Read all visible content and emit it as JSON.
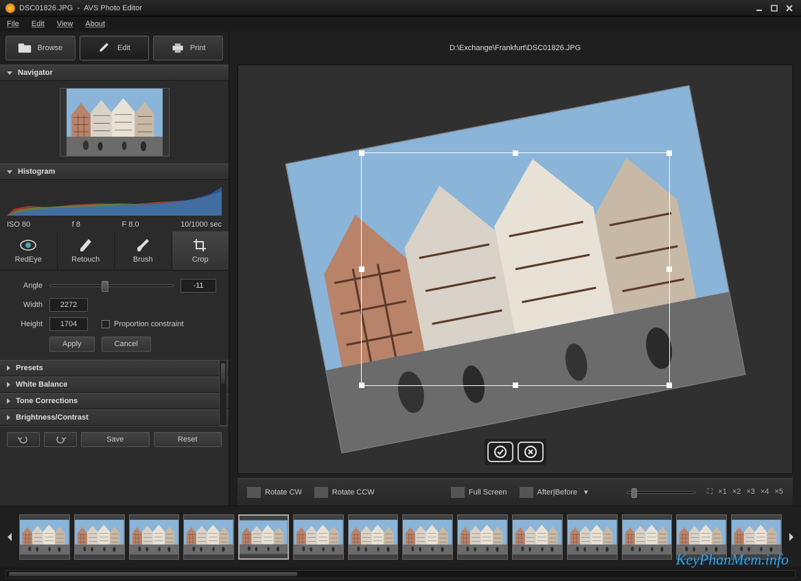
{
  "titlebar": {
    "filename": "DSC01826.JPG",
    "app": "AVS Photo Editor"
  },
  "menu": {
    "file": "File",
    "edit": "Edit",
    "view": "View",
    "about": "About"
  },
  "modes": {
    "browse": "Browse",
    "edit": "Edit",
    "print": "Print"
  },
  "sidebar": {
    "navigator": "Navigator",
    "histogram": "Histogram",
    "histo_info": {
      "iso": "ISO 80",
      "f1": "f 8",
      "f2": "F 8.0",
      "shutter": "10/1000 sec"
    },
    "tools": {
      "redeye": "RedEye",
      "retouch": "Retouch",
      "brush": "Brush",
      "crop": "Crop"
    },
    "crop": {
      "angle_label": "Angle",
      "angle_value": "-11",
      "width_label": "Width",
      "width_value": "2272",
      "height_label": "Height",
      "height_value": "1704",
      "proportion": "Proportion constraint",
      "apply": "Apply",
      "cancel": "Cancel"
    },
    "panels": {
      "presets": "Presets",
      "white_balance": "White Balance",
      "tone": "Tone Corrections",
      "brightness": "Brightness/Contrast"
    },
    "actions": {
      "save": "Save",
      "reset": "Reset"
    }
  },
  "canvas": {
    "filepath": "D:\\Exchange\\Frankfurt\\DSC01826.JPG"
  },
  "toolbar": {
    "rotate_cw": "Rotate CW",
    "rotate_ccw": "Rotate CCW",
    "fullscreen": "Full Screen",
    "after_before": "After|Before",
    "zoom": {
      "fit": "⛶",
      "x1": "×1",
      "x2": "×2",
      "x3": "×3",
      "x4": "×4",
      "x5": "×5"
    }
  },
  "watermark": "KeyPhanMem.info"
}
